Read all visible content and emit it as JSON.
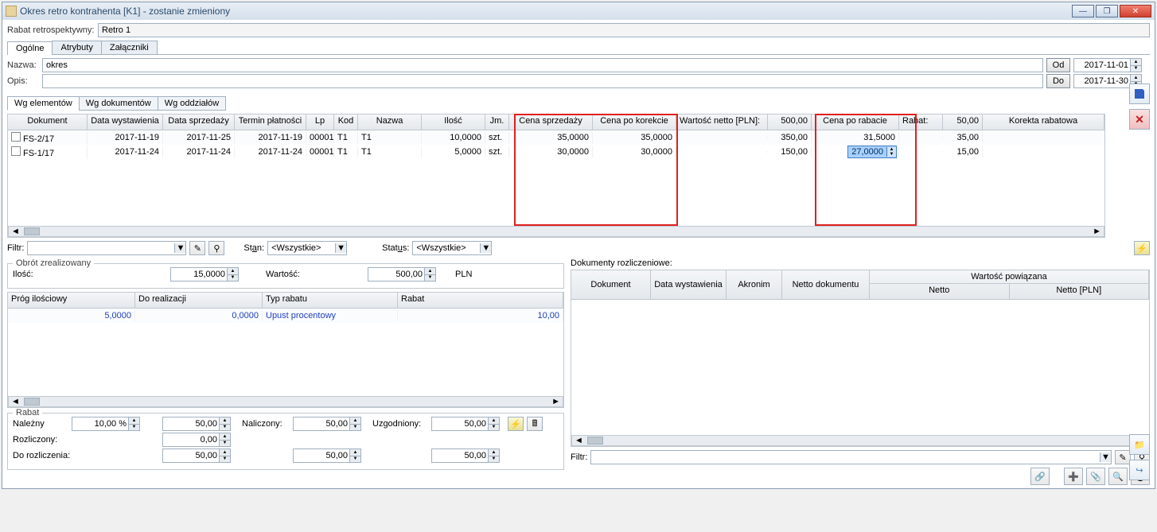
{
  "window": {
    "title": "Okres retro kontrahenta [K1] - zostanie zmieniony"
  },
  "header": {
    "rabat_label": "Rabat retrospektywny:",
    "rabat_value": "Retro 1"
  },
  "tabs": {
    "ogolne": "Ogólne",
    "atrybuty": "Atrybuty",
    "zalaczniki": "Załączniki"
  },
  "form": {
    "nazwa_label": "Nazwa:",
    "nazwa_value": "okres",
    "opis_label": "Opis:",
    "opis_value": "",
    "od_label": "Od",
    "od_value": "2017-11-01",
    "do_label": "Do",
    "do_value": "2017-11-30"
  },
  "subtabs": {
    "wg_elementow": "Wg elementów",
    "wg_dokumentow": "Wg dokumentów",
    "wg_oddzialow": "Wg oddziałów"
  },
  "main_grid": {
    "headers": {
      "dokument": "Dokument",
      "data_wyst": "Data wystawienia",
      "data_sprz": "Data sprzedaży",
      "termin": "Termin płatności",
      "lp": "Lp",
      "kod": "Kod",
      "nazwa": "Nazwa",
      "ilosc": "Ilość",
      "jm": "Jm.",
      "cena_sprz": "Cena sprzedaży",
      "cena_kor": "Cena po korekcie",
      "wart_netto_lbl": "Wartość netto [PLN]:",
      "wart_netto_val": "500,00",
      "cena_rabat": "Cena po rabacie",
      "rabat_lbl": "Rabat:",
      "rabat_val": "50,00",
      "korekta": "Korekta rabatowa"
    },
    "rows": [
      {
        "dok": "FS-2/17",
        "dw": "2017-11-19",
        "ds": "2017-11-25",
        "tp": "2017-11-19",
        "lp": "00001",
        "kod": "T1",
        "nazwa": "T1",
        "ilosc": "10,0000",
        "jm": "szt.",
        "csp": "35,0000",
        "ckor": "35,0000",
        "wn": "350,00",
        "crab": "31,5000",
        "rabat": "35,00",
        "kr": ""
      },
      {
        "dok": "FS-1/17",
        "dw": "2017-11-24",
        "ds": "2017-11-24",
        "tp": "2017-11-24",
        "lp": "00001",
        "kod": "T1",
        "nazwa": "T1",
        "ilosc": "5,0000",
        "jm": "szt.",
        "csp": "30,0000",
        "ckor": "30,0000",
        "wn": "150,00",
        "crab": "27,0000",
        "rabat": "15,00",
        "kr": ""
      }
    ]
  },
  "filters": {
    "filtr_label": "Filtr:",
    "stan_label": "Stan:",
    "stan_hotkey": "a",
    "stan_value": "<Wszystkie>",
    "status_label": "Status:",
    "status_hotkey": "u",
    "status_value": "<Wszystkie>"
  },
  "obrot": {
    "title": "Obrót zrealizowany",
    "ilosc_label": "Ilość:",
    "ilosc_value": "15,0000",
    "wartosc_label": "Wartość:",
    "wartosc_value": "500,00",
    "waluta": "PLN"
  },
  "prog_grid": {
    "headers": {
      "prog": "Próg ilościowy",
      "do": "Do realizacji",
      "typ": "Typ rabatu",
      "rabat": "Rabat"
    },
    "rows": [
      {
        "prog": "5,0000",
        "do": "0,0000",
        "typ": "Upust procentowy",
        "rabat": "10,00"
      }
    ]
  },
  "rabat_group": {
    "title": "Rabat",
    "nalezny": "Należny",
    "nalezny_pct": "10,00 %",
    "nalezny_val": "50,00",
    "naliczony": "Naliczony:",
    "naliczony_val": "50,00",
    "uzgodniony": "Uzgodniony:",
    "uzgodniony_val": "50,00",
    "rozliczony": "Rozliczony:",
    "rozliczony_val": "0,00",
    "do_rozl": "Do rozliczenia:",
    "do_rozl_val1": "50,00",
    "do_rozl_val2": "50,00",
    "do_rozl_val3": "50,00"
  },
  "dokumenty": {
    "title": "Dokumenty rozliczeniowe:",
    "headers": {
      "dokument": "Dokument",
      "data_wyst": "Data wystawienia",
      "akronim": "Akronim",
      "netto_dok": "Netto dokumentu",
      "wart_pow": "Wartość powiązana",
      "netto": "Netto",
      "netto_pln": "Netto [PLN]"
    },
    "filtr_label": "Filtr:"
  }
}
